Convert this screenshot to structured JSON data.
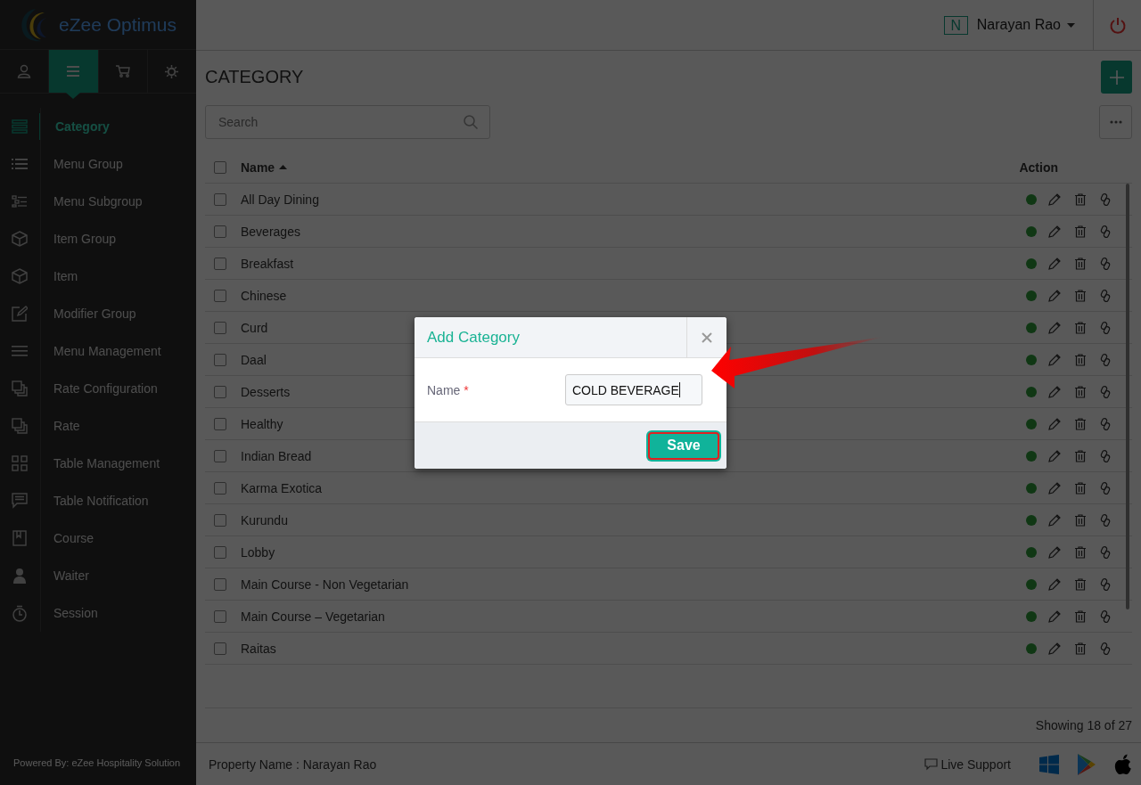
{
  "app": {
    "logo": "eZee Optimus",
    "powered_by": "Powered By: eZee Hospitality Solution"
  },
  "sidebar_tabs": [
    {
      "kind": "user",
      "selected": false
    },
    {
      "kind": "menu",
      "selected": true
    },
    {
      "kind": "cart",
      "selected": false
    },
    {
      "kind": "gear",
      "selected": false
    }
  ],
  "sidebar": {
    "items": [
      {
        "label": "Category",
        "kind": "list",
        "selected": true
      },
      {
        "label": "Menu Group",
        "kind": "bullets",
        "selected": false
      },
      {
        "label": "Menu Subgroup",
        "kind": "subgroup",
        "selected": false
      },
      {
        "label": "Item Group",
        "kind": "box",
        "selected": false
      },
      {
        "label": "Item",
        "kind": "box",
        "selected": false
      },
      {
        "label": "Modifier Group",
        "kind": "edit",
        "selected": false
      },
      {
        "label": "Menu Management",
        "kind": "menu",
        "selected": false
      },
      {
        "label": "Rate Configuration",
        "kind": "copy",
        "selected": false
      },
      {
        "label": "Rate",
        "kind": "copy",
        "selected": false
      },
      {
        "label": "Table Management",
        "kind": "grid",
        "selected": false
      },
      {
        "label": "Table Notification",
        "kind": "chat",
        "selected": false
      },
      {
        "label": "Course",
        "kind": "book",
        "selected": false
      },
      {
        "label": "Waiter",
        "kind": "person",
        "selected": false
      },
      {
        "label": "Session",
        "kind": "timer",
        "selected": false
      }
    ]
  },
  "header": {
    "user_initial": "N",
    "user_name": "Narayan Rao"
  },
  "page": {
    "title": "CATEGORY",
    "search_placeholder": "Search"
  },
  "table": {
    "columns": [
      "Name",
      "Action"
    ],
    "all_checked": false,
    "rows": [
      {
        "name": "All Day Dining",
        "checked": false,
        "active": true
      },
      {
        "name": "Beverages",
        "checked": false,
        "active": true
      },
      {
        "name": "Breakfast",
        "checked": false,
        "active": true
      },
      {
        "name": "Chinese",
        "checked": false,
        "active": true
      },
      {
        "name": "Curd",
        "checked": false,
        "active": true
      },
      {
        "name": "Daal",
        "checked": false,
        "active": true
      },
      {
        "name": "Desserts",
        "checked": false,
        "active": true
      },
      {
        "name": "Healthy",
        "checked": false,
        "active": true
      },
      {
        "name": "Indian Bread",
        "checked": false,
        "active": true
      },
      {
        "name": "Karma Exotica",
        "checked": false,
        "active": true
      },
      {
        "name": "Kurundu",
        "checked": false,
        "active": true
      },
      {
        "name": "Lobby",
        "checked": false,
        "active": true
      },
      {
        "name": "Main Course - Non Vegetarian",
        "checked": false,
        "active": true
      },
      {
        "name": "Main Course – Vegetarian",
        "checked": false,
        "active": true
      },
      {
        "name": "Raitas",
        "checked": false,
        "active": true
      }
    ],
    "showing": "Showing 18 of 27"
  },
  "footer": {
    "property": "Property Name : Narayan Rao",
    "live_support": "Live Support"
  },
  "dialog": {
    "title": "Add Category",
    "field_label": "Name",
    "required_mark": "*",
    "value": "COLD BEVERAGE",
    "button": "Save"
  }
}
